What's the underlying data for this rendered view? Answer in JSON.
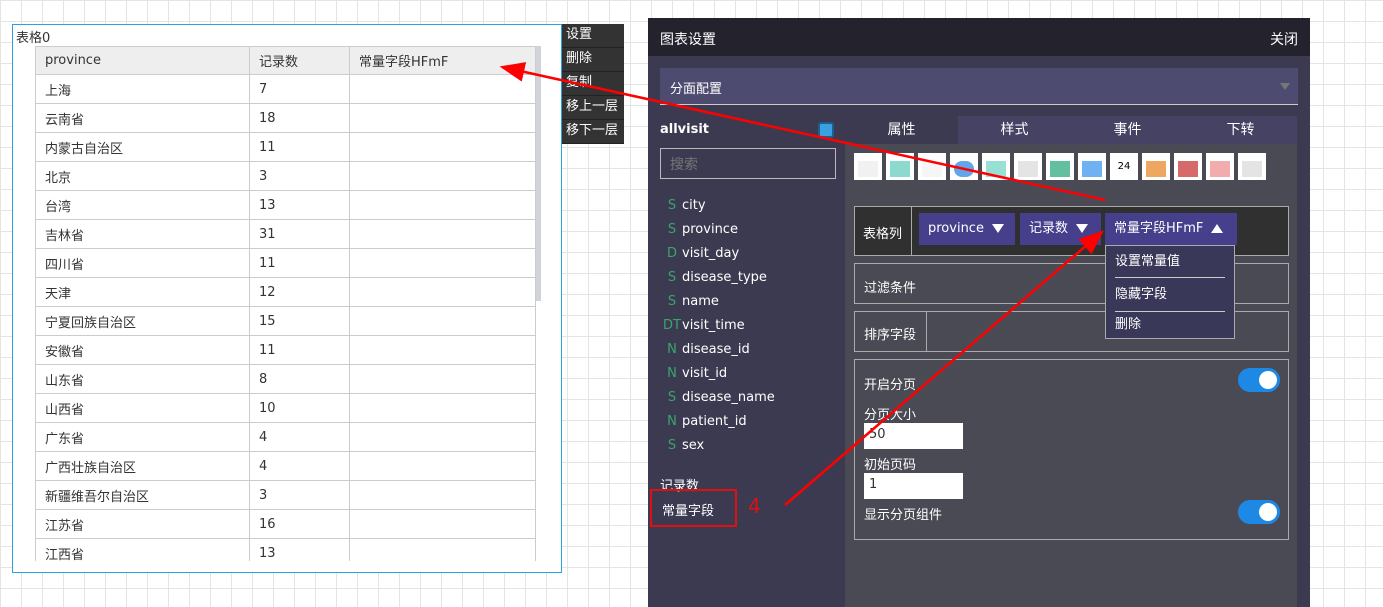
{
  "widget": {
    "title": "表格0",
    "columns": [
      "province",
      "记录数",
      "常量字段HFmF"
    ],
    "rows": [
      [
        "上海",
        "7"
      ],
      [
        "云南省",
        "18"
      ],
      [
        "内蒙古自治区",
        "11"
      ],
      [
        "北京",
        "3"
      ],
      [
        "台湾",
        "13"
      ],
      [
        "吉林省",
        "31"
      ],
      [
        "四川省",
        "11"
      ],
      [
        "天津",
        "12"
      ],
      [
        "宁夏回族自治区",
        "15"
      ],
      [
        "安徽省",
        "11"
      ],
      [
        "山东省",
        "8"
      ],
      [
        "山西省",
        "10"
      ],
      [
        "广东省",
        "4"
      ],
      [
        "广西壮族自治区",
        "4"
      ],
      [
        "新疆维吾尔自治区",
        "3"
      ],
      [
        "江苏省",
        "16"
      ],
      [
        "江西省",
        "13"
      ]
    ]
  },
  "context_menu": [
    "设置",
    "删除",
    "复制",
    "移上一层",
    "移下一层"
  ],
  "panel": {
    "title": "图表设置",
    "close": "关闭",
    "facet": "分面配置",
    "dataset": "allvisit",
    "search_placeholder": "搜索",
    "fields": [
      {
        "type": "S",
        "name": "city"
      },
      {
        "type": "S",
        "name": "province"
      },
      {
        "type": "D",
        "name": "visit_day"
      },
      {
        "type": "S",
        "name": "disease_type"
      },
      {
        "type": "S",
        "name": "name"
      },
      {
        "type": "DT",
        "name": "visit_time"
      },
      {
        "type": "N",
        "name": "disease_id"
      },
      {
        "type": "N",
        "name": "visit_id"
      },
      {
        "type": "S",
        "name": "disease_name"
      },
      {
        "type": "N",
        "name": "patient_id"
      },
      {
        "type": "S",
        "name": "sex"
      }
    ],
    "measure": "记录数",
    "constant": "常量字段",
    "tabs": [
      "属性",
      "样式",
      "事件",
      "下转"
    ],
    "thumb_number": "24",
    "table_columns_label": "表格列",
    "chips": [
      "province",
      "记录数",
      "常量字段HFmF"
    ],
    "chip_menu": [
      "设置常量值",
      "隐藏字段",
      "删除"
    ],
    "filter_label": "过滤条件",
    "sort_label": "排序字段",
    "paging_label": "开启分页",
    "page_size_label": "分页大小",
    "page_size": "50",
    "start_page_label": "初始页码",
    "start_page": "1",
    "show_pager_label": "显示分页组件",
    "paging_on": true,
    "show_pager_on": true
  },
  "annotation": "4",
  "colors": {
    "accent": "#453f8c",
    "toggle": "#1e88e5",
    "arrow": "#ff0000"
  }
}
